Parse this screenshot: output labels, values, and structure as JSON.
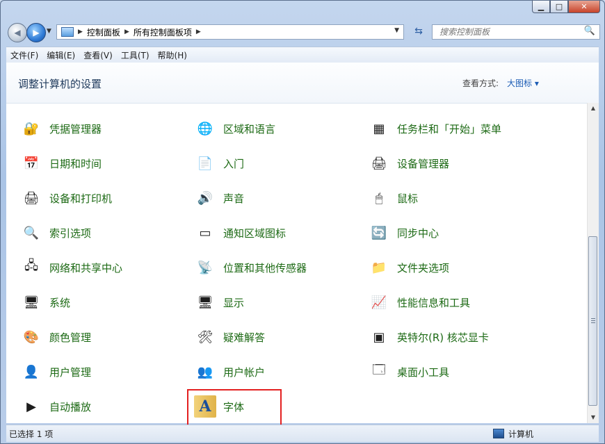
{
  "address": {
    "crumbs": [
      "控制面板",
      "所有控制面板项"
    ]
  },
  "search": {
    "placeholder": "搜索控制面板"
  },
  "menu": [
    "文件(F)",
    "编辑(E)",
    "查看(V)",
    "工具(T)",
    "帮助(H)"
  ],
  "header": {
    "title": "调整计算机的设置",
    "view_by_label": "查看方式:",
    "view_by_value": "大图标 ▾"
  },
  "items": [
    {
      "label": "凭据管理器",
      "icon": "credential-manager-icon"
    },
    {
      "label": "区域和语言",
      "icon": "globe-icon"
    },
    {
      "label": "任务栏和「开始」菜单",
      "icon": "taskbar-icon"
    },
    {
      "label": "日期和时间",
      "icon": "calendar-clock-icon"
    },
    {
      "label": "入门",
      "icon": "getting-started-icon"
    },
    {
      "label": "设备管理器",
      "icon": "device-manager-icon"
    },
    {
      "label": "设备和打印机",
      "icon": "printer-icon"
    },
    {
      "label": "声音",
      "icon": "speaker-icon"
    },
    {
      "label": "鼠标",
      "icon": "mouse-icon"
    },
    {
      "label": "索引选项",
      "icon": "index-magnifier-icon"
    },
    {
      "label": "通知区域图标",
      "icon": "notification-area-icon"
    },
    {
      "label": "同步中心",
      "icon": "sync-center-icon"
    },
    {
      "label": "网络和共享中心",
      "icon": "network-icon"
    },
    {
      "label": "位置和其他传感器",
      "icon": "location-sensor-icon"
    },
    {
      "label": "文件夹选项",
      "icon": "folder-options-icon"
    },
    {
      "label": "系统",
      "icon": "system-icon"
    },
    {
      "label": "显示",
      "icon": "display-icon"
    },
    {
      "label": "性能信息和工具",
      "icon": "performance-icon"
    },
    {
      "label": "颜色管理",
      "icon": "color-management-icon"
    },
    {
      "label": "疑难解答",
      "icon": "troubleshooting-icon"
    },
    {
      "label": "英特尔(R) 核芯显卡",
      "icon": "intel-graphics-icon"
    },
    {
      "label": "用户管理",
      "icon": "user-management-icon"
    },
    {
      "label": "用户帐户",
      "icon": "user-accounts-icon"
    },
    {
      "label": "桌面小工具",
      "icon": "desktop-gadgets-icon"
    },
    {
      "label": "自动播放",
      "icon": "autoplay-icon"
    },
    {
      "label": "字体",
      "icon": "fonts-icon"
    }
  ],
  "status": {
    "left": "已选择 1 项",
    "right": "计算机"
  }
}
